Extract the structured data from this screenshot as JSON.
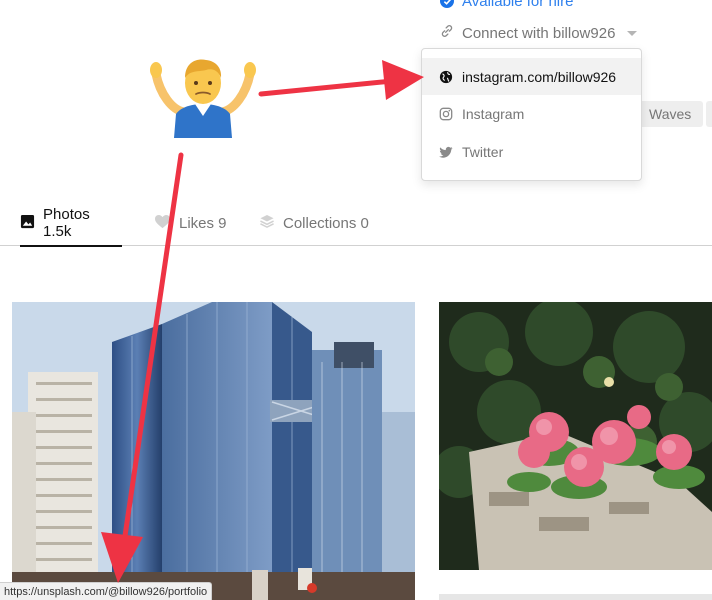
{
  "profile": {
    "hire_label": "Available for hire",
    "connect_label": "Connect with billow926"
  },
  "connect_menu": {
    "items": [
      {
        "label": "instagram.com/billow926",
        "icon": "globe-icon",
        "active": true
      },
      {
        "label": "Instagram",
        "icon": "instagram-icon",
        "active": false
      },
      {
        "label": "Twitter",
        "icon": "twitter-icon",
        "active": false
      }
    ]
  },
  "tags": [
    "Waves"
  ],
  "tabs": [
    {
      "label": "Photos 1.5k",
      "icon": "image-icon",
      "active": true
    },
    {
      "label": "Likes 9",
      "icon": "heart-icon",
      "active": false
    },
    {
      "label": "Collections 0",
      "icon": "stack-icon",
      "active": false
    }
  ],
  "status_url": "https://unsplash.com/@billow926/portfolio",
  "annotation": {
    "emoji": "shrug-emoji",
    "arrow_color": "#ee3344"
  },
  "colors": {
    "accent_blue": "#2f80ed",
    "text_muted": "#767676",
    "text_active": "#111111"
  }
}
